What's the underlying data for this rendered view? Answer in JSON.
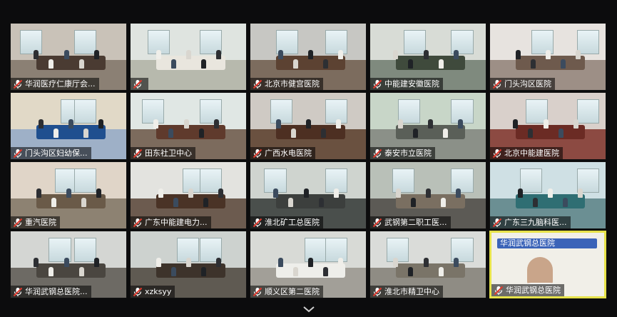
{
  "participants": [
    {
      "name": "华润医疗仁康厅会..."
    },
    {
      "name": ""
    },
    {
      "name": "北京市健宫医院"
    },
    {
      "name": "中能建安徽医院"
    },
    {
      "name": "门头沟区医院"
    },
    {
      "name": "门头沟区妇幼保..."
    },
    {
      "name": "田东社卫中心"
    },
    {
      "name": "广西水电医院"
    },
    {
      "name": "泰安市立医院"
    },
    {
      "name": "北京中能建医院"
    },
    {
      "name": "重汽医院"
    },
    {
      "name": "广东中能建电力..."
    },
    {
      "name": "淮北矿工总医院"
    },
    {
      "name": "武钢第二职工医..."
    },
    {
      "name": "广东三九脑科医..."
    },
    {
      "name": "华润武钢总医院..."
    },
    {
      "name": "xzksyy"
    },
    {
      "name": "顺义区第二医院"
    },
    {
      "name": "淮北市精卫中心"
    },
    {
      "name": "华润武钢总医院"
    }
  ],
  "active_speaker_banner": "华润武钢总医院",
  "colors": {
    "active_border": "#e6e24a",
    "mic_muted": "#e03a2e"
  },
  "icons": {
    "muted": "mic-muted-icon",
    "more": "chevron-down-icon"
  }
}
